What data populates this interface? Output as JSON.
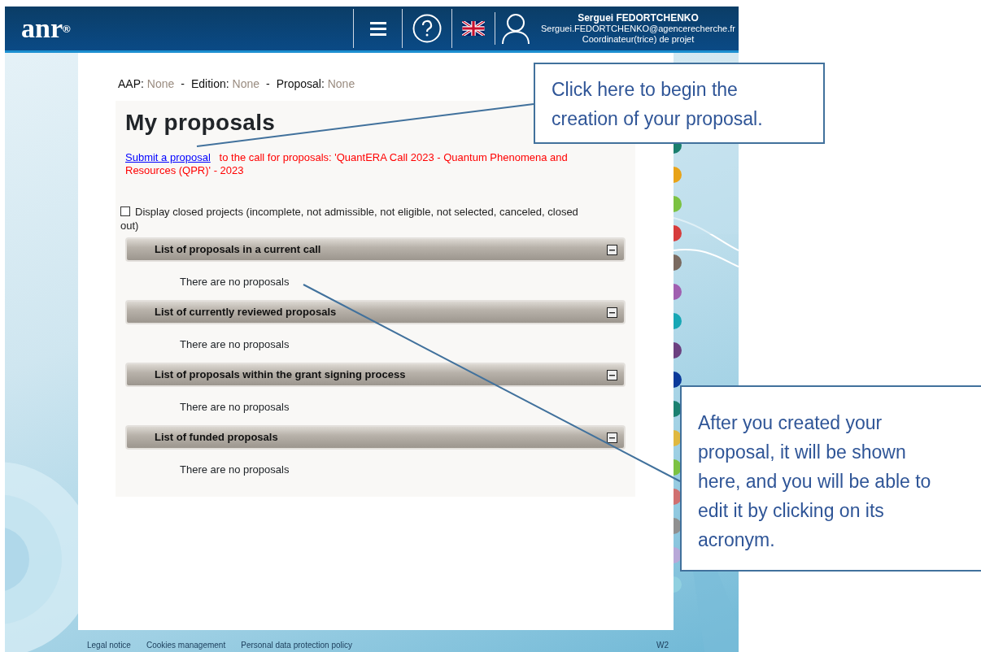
{
  "header": {
    "logo": "anr",
    "logo_mark": "®",
    "user": {
      "name": "Serguei FEDORTCHENKO",
      "email": "Serguei.FEDORTCHENKO@agencerecherche.fr",
      "role": "Coordinateur(trice) de projet"
    }
  },
  "context": [
    {
      "label": "AAP:",
      "value": "None"
    },
    {
      "label": "Edition:",
      "value": "None"
    },
    {
      "label": "Proposal:",
      "value": "None"
    }
  ],
  "context_separators": [
    "-",
    "-"
  ],
  "page_title": "My proposals",
  "submit": {
    "link": "Submit a proposal",
    "text": "to the call for proposals: 'QuantERA Call 2023 - Quantum Phenomena and Resources (QPR)' - 2023"
  },
  "closed_filter": {
    "label": "Display closed projects (incomplete, not admissible, not eligible, not selected, canceled, closed out)",
    "checked": false
  },
  "sections": [
    {
      "title": "List of proposals in a current call",
      "expanded": true,
      "message": "There are no proposals"
    },
    {
      "title": "List of currently reviewed proposals",
      "expanded": true,
      "message": "There are no proposals"
    },
    {
      "title": "List of proposals within the grant signing process",
      "expanded": true,
      "message": "There are no proposals"
    },
    {
      "title": "List of funded proposals",
      "expanded": true,
      "message": "There are no proposals"
    }
  ],
  "footer": {
    "links": [
      "Legal notice",
      "Cookies management",
      "Personal data protection policy"
    ],
    "version": "W2"
  },
  "callouts": [
    {
      "text": "Click here to begin the creation of your proposal."
    },
    {
      "text": "After you created your proposal, it will be shown here, and you will be able to edit it by clicking on its acronym."
    }
  ]
}
